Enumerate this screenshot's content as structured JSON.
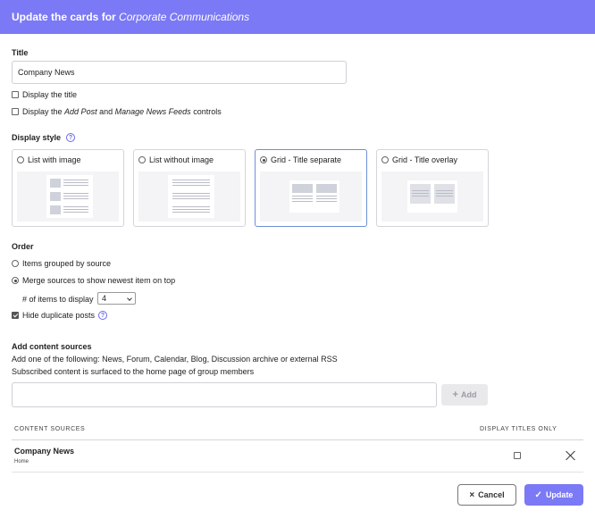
{
  "header": {
    "prefix": "Update the cards for",
    "group_name": "Corporate Communications"
  },
  "title_section": {
    "label": "Title",
    "value": "Company News",
    "display_title_label": "Display the title",
    "display_title_checked": false,
    "controls_prefix": "Display the",
    "controls_add_post": "Add Post",
    "controls_and": "and",
    "controls_manage": "Manage News Feeds",
    "controls_suffix": "controls",
    "controls_checked": false
  },
  "display_style": {
    "label": "Display style",
    "help": "?",
    "options": [
      {
        "label": "List with image",
        "selected": false
      },
      {
        "label": "List without image",
        "selected": false
      },
      {
        "label": "Grid - Title separate",
        "selected": true
      },
      {
        "label": "Grid - Title overlay",
        "selected": false
      }
    ]
  },
  "order": {
    "label": "Order",
    "grouped_label": "Items grouped by source",
    "merge_label": "Merge sources to show newest item on top",
    "selected": "merge",
    "items_label": "# of items to display",
    "items_value": "4",
    "hide_duplicates_label": "Hide duplicate posts",
    "hide_duplicates_checked": true,
    "help": "?"
  },
  "content_sources": {
    "label": "Add content sources",
    "description1": "Add one of the following: News, Forum, Calendar, Blog, Discussion archive or external RSS",
    "description2": "Subscribed content is surfaced to the home page of group members",
    "input_value": "",
    "add_label": "Add",
    "col_sources": "CONTENT SOURCES",
    "col_titles_only": "DISPLAY TITLES ONLY",
    "rows": [
      {
        "name": "Company News",
        "sub": "Home",
        "titles_only": false
      }
    ]
  },
  "footer": {
    "cancel_label": "Cancel",
    "update_label": "Update"
  },
  "colors": {
    "accent": "#7b79f5",
    "selected_border": "#6e8fd6"
  }
}
